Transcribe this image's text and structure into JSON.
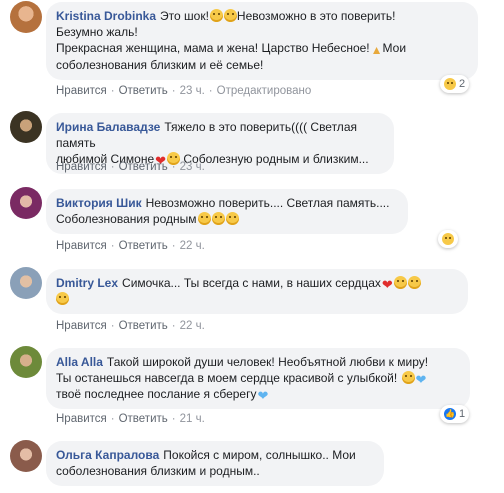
{
  "actions": {
    "like": "Нравится",
    "reply": "Ответить",
    "separator": "·"
  },
  "comments": [
    {
      "author": "Kristina Drobinka",
      "lines": [
        "Это шок!",
        "Невозможно в это поверить!",
        "Безумно жаль!",
        "Прекрасная женщина, мама и жена! Царство Небесное!",
        "Мои",
        "соболезнования близким и её семье!"
      ],
      "time": "23 ч.",
      "edited": "Отредактировано",
      "reaction_count": "2",
      "avatar_color": "#c98a5a"
    },
    {
      "author": "Ирина Балавадзе",
      "lines": [
        "Тяжело в это поверить(((( Светлая память",
        "любимой Симоне",
        "Соболезную родным и близким..."
      ],
      "time": "23 ч.",
      "avatar_color": "#3b3323"
    },
    {
      "author": "Виктория Шик",
      "lines": [
        "Невозможно поверить.... Светлая память....",
        "Соболезнования родным"
      ],
      "time": "22 ч.",
      "avatar_color": "#7a2a63"
    },
    {
      "author": "Dmitry Lex",
      "lines": [
        "Симочка... Ты всегда с нами, в наших сердцах"
      ],
      "time": "22 ч.",
      "avatar_color": "#8aa0b8"
    },
    {
      "author": "Alla Alla",
      "lines": [
        "Такой широкой души человек! Необъятной любви к миру!",
        "Ты останешься навсегда в моем сердце красивой с улыбкой!",
        "твоё последнее послание я сберегу"
      ],
      "time": "21 ч.",
      "reaction_count": "1",
      "avatar_color": "#6d8a3a"
    },
    {
      "author": "Ольга Капралова",
      "lines": [
        "Покойся с миром, солнышко.. Мои",
        "соболезнования близким и родным.."
      ],
      "avatar_color": "#8a5b4b"
    }
  ]
}
